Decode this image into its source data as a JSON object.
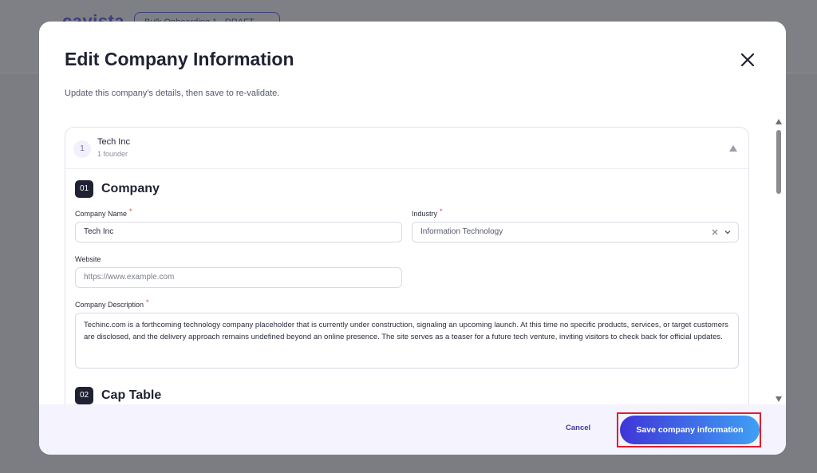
{
  "background": {
    "logo": "cavista",
    "pill": "Bulk Onboarding 1 - DRAFT"
  },
  "modal": {
    "title": "Edit Company Information",
    "subtitle": "Update this company's details, then save to re-validate."
  },
  "company_card": {
    "index": "1",
    "name": "Tech Inc",
    "founders": "1 founder"
  },
  "sections": {
    "company": {
      "badge": "01",
      "title": "Company"
    },
    "cap_table": {
      "badge": "02",
      "title": "Cap Table"
    }
  },
  "form": {
    "company_name_label": "Company Name",
    "company_name_value": "Tech Inc",
    "industry_label": "Industry",
    "industry_value": "Information Technology",
    "website_label": "Website",
    "website_placeholder": "https://www.example.com",
    "description_label": "Company Description",
    "description_value": "Techinc.com is a forthcoming technology company placeholder that is currently under construction, signaling an upcoming launch. At this time no specific products, services, or target customers are disclosed, and the delivery approach remains undefined beyond an online presence. The site serves as a teaser for a future tech venture, inviting visitors to check back for official updates.",
    "required_mark": "*"
  },
  "footer": {
    "cancel_label": "Cancel",
    "save_label": "Save company information"
  },
  "colors": {
    "accent": "#3f36d8",
    "accent_end": "#3fa0f4",
    "highlight": "#e01e2e",
    "required": "#e2483d"
  }
}
